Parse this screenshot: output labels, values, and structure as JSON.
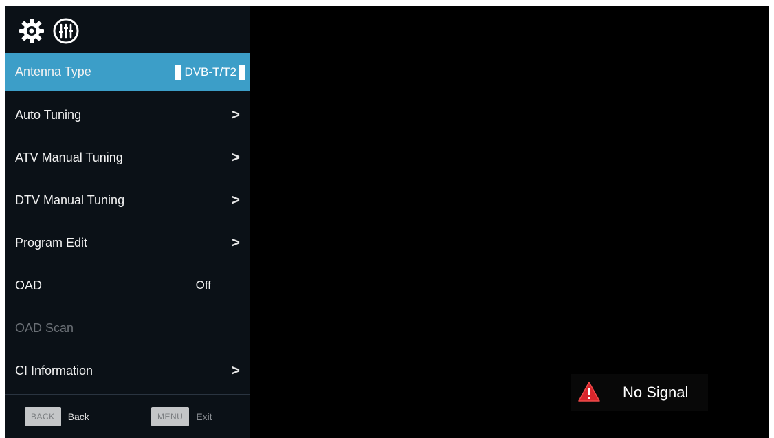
{
  "menu": {
    "top_icons": [
      "gear-icon",
      "equalizer-icon"
    ],
    "items": [
      {
        "label": "Antenna Type",
        "value": "DVB-T/T2",
        "kind": "select",
        "selected": true
      },
      {
        "label": "Auto Tuning",
        "kind": "submenu"
      },
      {
        "label": "ATV Manual Tuning",
        "kind": "submenu"
      },
      {
        "label": "DTV Manual Tuning",
        "kind": "submenu"
      },
      {
        "label": "Program Edit",
        "kind": "submenu"
      },
      {
        "label": "OAD",
        "value": "Off",
        "kind": "value"
      },
      {
        "label": "OAD Scan",
        "kind": "disabled"
      },
      {
        "label": "CI Information",
        "kind": "submenu"
      }
    ],
    "chevron": ">"
  },
  "footer": {
    "back_key": "BACK",
    "back_label": "Back",
    "menu_key": "MENU",
    "menu_label": "Exit"
  },
  "status": {
    "icon": "warning-icon",
    "text": "No Signal"
  },
  "colors": {
    "selected_bg": "#3c9ec8",
    "panel_bg": "#0b1117",
    "warning": "#d8262c"
  }
}
